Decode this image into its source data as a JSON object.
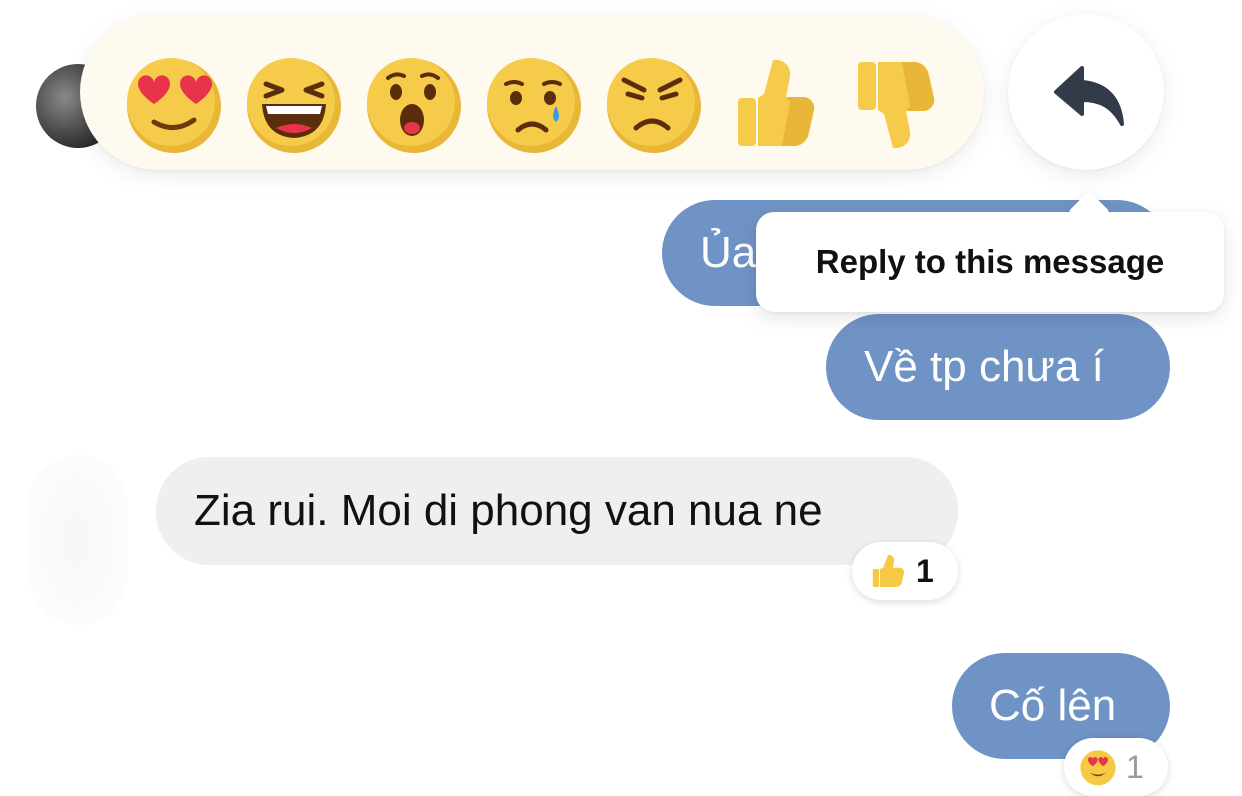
{
  "reaction_bar": {
    "reactions": [
      {
        "name": "love"
      },
      {
        "name": "haha"
      },
      {
        "name": "wow"
      },
      {
        "name": "sad"
      },
      {
        "name": "angry"
      },
      {
        "name": "like"
      },
      {
        "name": "dislike"
      }
    ]
  },
  "tooltip": {
    "text": "Reply to this message"
  },
  "messages": [
    {
      "id": "m1",
      "direction": "outgoing",
      "text": "Ủa"
    },
    {
      "id": "m2",
      "direction": "outgoing",
      "text": "Về tp chưa í"
    },
    {
      "id": "m3",
      "direction": "incoming",
      "text": "Zia rui. Moi di phong van nua ne",
      "reaction": {
        "icon": "thumbs-up-icon",
        "count": "1"
      }
    },
    {
      "id": "m4",
      "direction": "outgoing",
      "text": "Cố lên",
      "reaction": {
        "icon": "heart-eyes-icon",
        "count": "1"
      }
    }
  ],
  "colors": {
    "outgoing_bubble": "#6f93c4",
    "outgoing_bubble_selected": "#5e7fae",
    "incoming_bubble": "#efefef",
    "emoji_yellow": "#f6c944"
  }
}
